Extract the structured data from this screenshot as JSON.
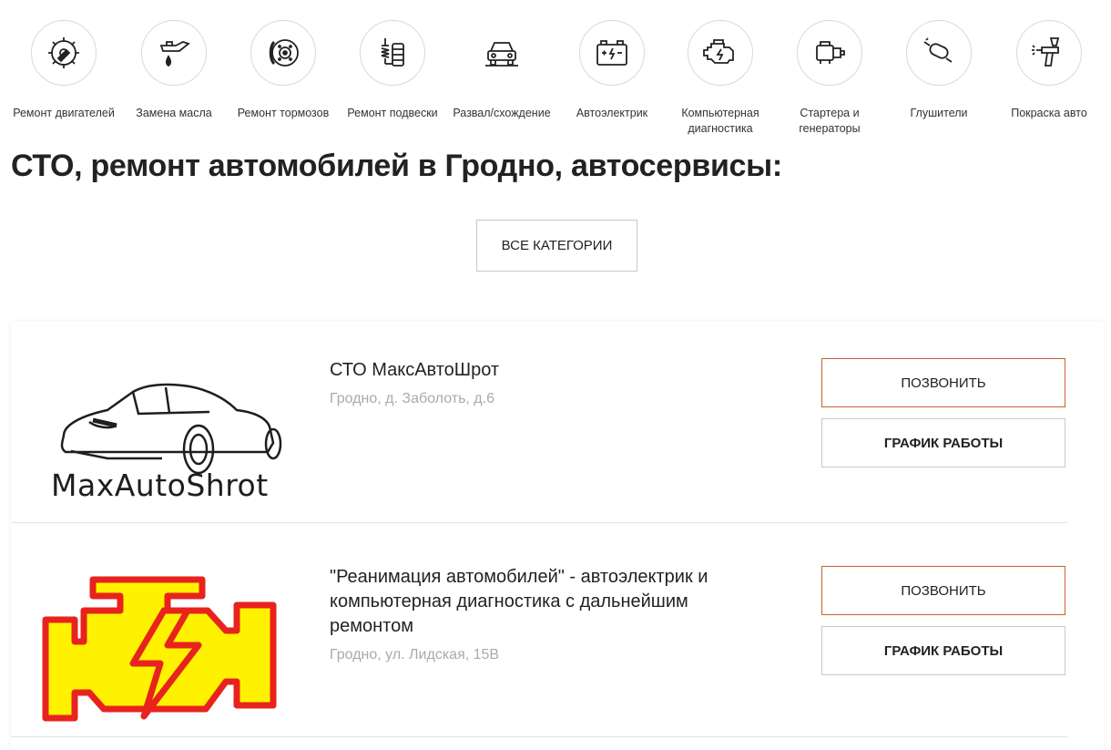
{
  "categories": [
    {
      "label": "Ремонт двигателей",
      "icon": "engine-gear-icon"
    },
    {
      "label": "Замена масла",
      "icon": "oil-can-icon"
    },
    {
      "label": "Ремонт тормозов",
      "icon": "brake-disc-icon"
    },
    {
      "label": "Ремонт подвески",
      "icon": "suspension-icon"
    },
    {
      "label": "Развал/схождение",
      "icon": "car-front-icon"
    },
    {
      "label": "Автоэлектрик",
      "icon": "battery-icon"
    },
    {
      "label": "Компьютерная диагностика",
      "icon": "engine-diagnostics-icon"
    },
    {
      "label": "Стартера и генераторы",
      "icon": "starter-icon"
    },
    {
      "label": "Глушители",
      "icon": "muffler-icon"
    },
    {
      "label": "Покраска авто",
      "icon": "spray-gun-icon"
    }
  ],
  "page_title": "СТО, ремонт автомобилей в Гродно, автосервисы:",
  "all_categories_label": "ВСЕ КАТЕГОРИИ",
  "listings": [
    {
      "name": "СТО МаксАвтоШрот",
      "address": "Гродно, д. Заболоть, д.6",
      "logo_text": "MaxAutoShrot",
      "call_label": "ПОЗВОНИТЬ",
      "schedule_label": "ГРАФИК РАБОТЫ"
    },
    {
      "name": "\"Реанимация автомобилей\" - автоэлектрик и компьютерная диагностика с дальнейшим ремонтом",
      "address": "Гродно, ул. Лидская, 15В",
      "call_label": "ПОЗВОНИТЬ",
      "schedule_label": "ГРАФИК РАБОТЫ"
    }
  ],
  "colors": {
    "call_border": "#c9602e",
    "address_text": "#aaaaaa",
    "logo_red": "#e8231e",
    "logo_yellow": "#fff200"
  }
}
